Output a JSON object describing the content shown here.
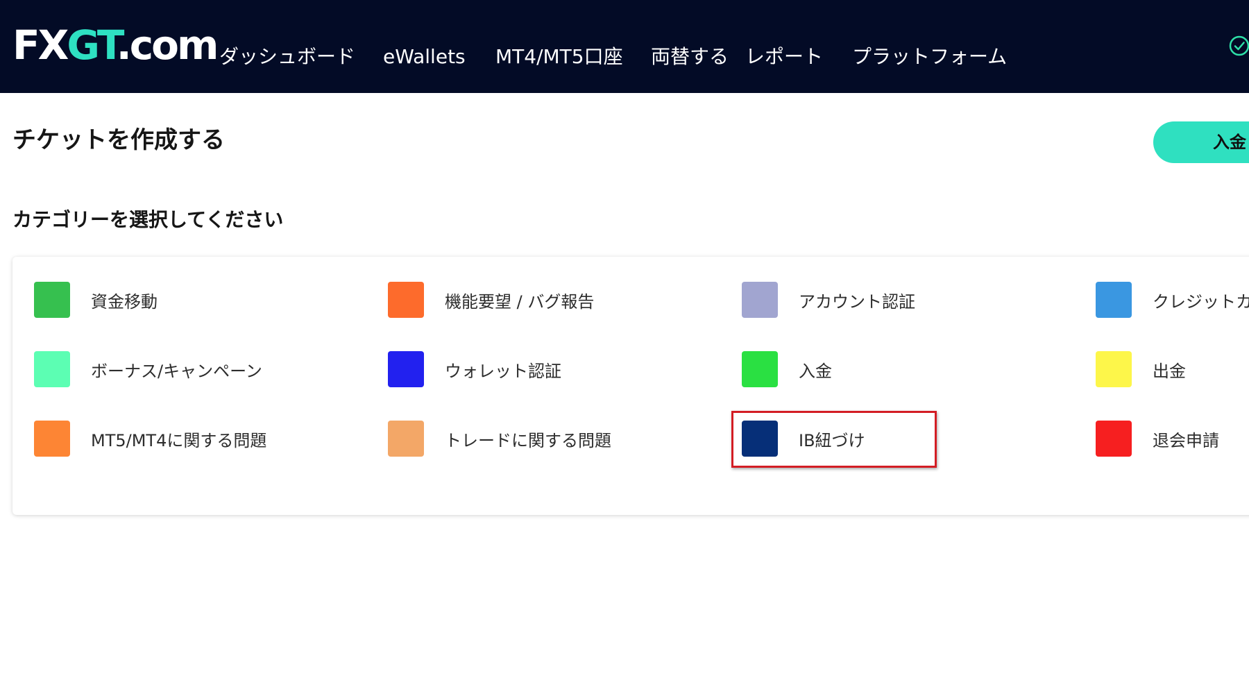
{
  "header": {
    "logo": {
      "part1": "FX",
      "part2": "GT",
      "part3": ".com"
    },
    "nav": [
      {
        "label": "ダッシュボード"
      },
      {
        "label": "eWallets"
      },
      {
        "label": "MT4/MT5口座"
      },
      {
        "label": "両替する"
      },
      {
        "label": "レポート"
      },
      {
        "label": "プラットフォーム"
      }
    ],
    "status_icon": "check-circle-icon"
  },
  "page": {
    "title": "チケットを作成する",
    "deposit_button": "入金",
    "section_title": "カテゴリーを選択してください"
  },
  "categories": [
    {
      "label": "資金移動",
      "color": "#36c04f"
    },
    {
      "label": "機能要望 / バグ報告",
      "color": "#fd6b2c"
    },
    {
      "label": "アカウント認証",
      "color": "#a1a5d0"
    },
    {
      "label": "クレジットカ",
      "color": "#3a97e1"
    },
    {
      "label": "ボーナス/キャンペーン",
      "color": "#5cfeb3"
    },
    {
      "label": "ウォレット認証",
      "color": "#2221ef"
    },
    {
      "label": "入金",
      "color": "#2ae042"
    },
    {
      "label": "出金",
      "color": "#fdf64a"
    },
    {
      "label": "MT5/MT4に関する問題",
      "color": "#fd8534"
    },
    {
      "label": "トレードに関する問題",
      "color": "#f3a767"
    },
    {
      "label": "IB紐づけ",
      "color": "#062f78"
    },
    {
      "label": "退会申請",
      "color": "#f61f20"
    }
  ],
  "colors": {
    "header_bg": "#030b26",
    "accent": "#2fe0c0",
    "highlight_border": "#d31d24"
  }
}
